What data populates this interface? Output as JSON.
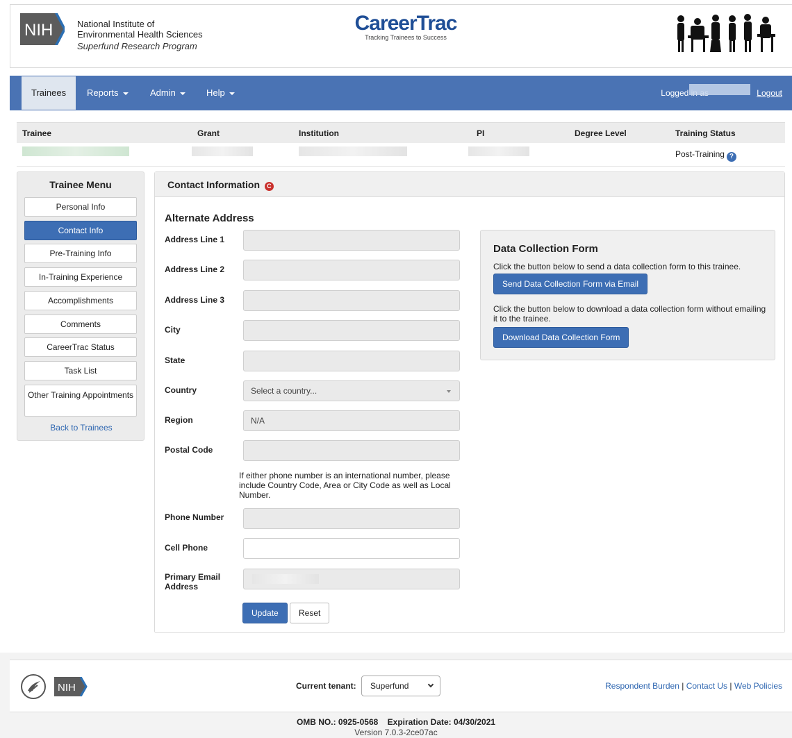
{
  "header": {
    "nih_logo_text": "NIH",
    "institute_line1": "National Institute of",
    "institute_line2": "Environmental Health Sciences",
    "program": "Superfund Research Program",
    "brand": "CareerTrac",
    "tagline": "Tracking Trainees to Success"
  },
  "navbar": {
    "items": [
      {
        "label": "Trainees"
      },
      {
        "label": "Reports"
      },
      {
        "label": "Admin"
      },
      {
        "label": "Help"
      }
    ],
    "logged_in_label": "Logged in as",
    "logout_label": "Logout"
  },
  "trainee_table": {
    "headers": [
      "Trainee",
      "Grant",
      "Institution",
      "PI",
      "Degree Level",
      "Training Status"
    ],
    "status": "Post-Training"
  },
  "sidebar": {
    "title": "Trainee Menu",
    "items": [
      {
        "label": "Personal Info"
      },
      {
        "label": "Contact Info"
      },
      {
        "label": "Pre-Training Info"
      },
      {
        "label": "In-Training Experience"
      },
      {
        "label": "Accomplishments"
      },
      {
        "label": "Comments"
      },
      {
        "label": "CareerTrac Status"
      },
      {
        "label": "Task List"
      },
      {
        "label": "Other Training Appointments"
      }
    ],
    "back_label": "Back to Trainees"
  },
  "panel": {
    "title": "Contact Information",
    "section_title": "Alternate Address",
    "fields": [
      {
        "label": "Address Line 1",
        "value": ""
      },
      {
        "label": "Address Line 2",
        "value": ""
      },
      {
        "label": "Address Line 3",
        "value": ""
      },
      {
        "label": "City",
        "value": ""
      },
      {
        "label": "State",
        "value": ""
      },
      {
        "label": "Country",
        "value": "Select a country..."
      },
      {
        "label": "Region",
        "value": "N/A"
      },
      {
        "label": "Postal Code",
        "value": ""
      },
      {
        "label": "Phone Number",
        "value": ""
      },
      {
        "label": "Cell Phone",
        "value": ""
      },
      {
        "label": "Primary Email Address",
        "value": ""
      }
    ],
    "phone_note": "If either phone number is an international number, please include Country Code, Area or City Code as well as Local Number.",
    "update_label": "Update",
    "reset_label": "Reset"
  },
  "dcf": {
    "title": "Data Collection Form",
    "text1": "Click the button below to send a data collection form to this trainee.",
    "send_label": "Send Data Collection Form via Email",
    "text2": "Click the button below to download a data collection form without emailing it to the trainee.",
    "download_label": "Download Data Collection Form"
  },
  "footer": {
    "nih_text": "NIH",
    "tenant_label": "Current tenant:",
    "tenant_value": "Superfund",
    "links": [
      "Respondent Burden",
      "Contact Us",
      "Web Policies"
    ],
    "omb": "OMB NO.: 0925-0568    Expiration Date: 04/30/2021",
    "version": "Version 7.0.3-2ce07ac"
  },
  "colors": {
    "navbar": "#4a73b4",
    "primary": "#3d6eb4",
    "link": "#2f67b1"
  }
}
